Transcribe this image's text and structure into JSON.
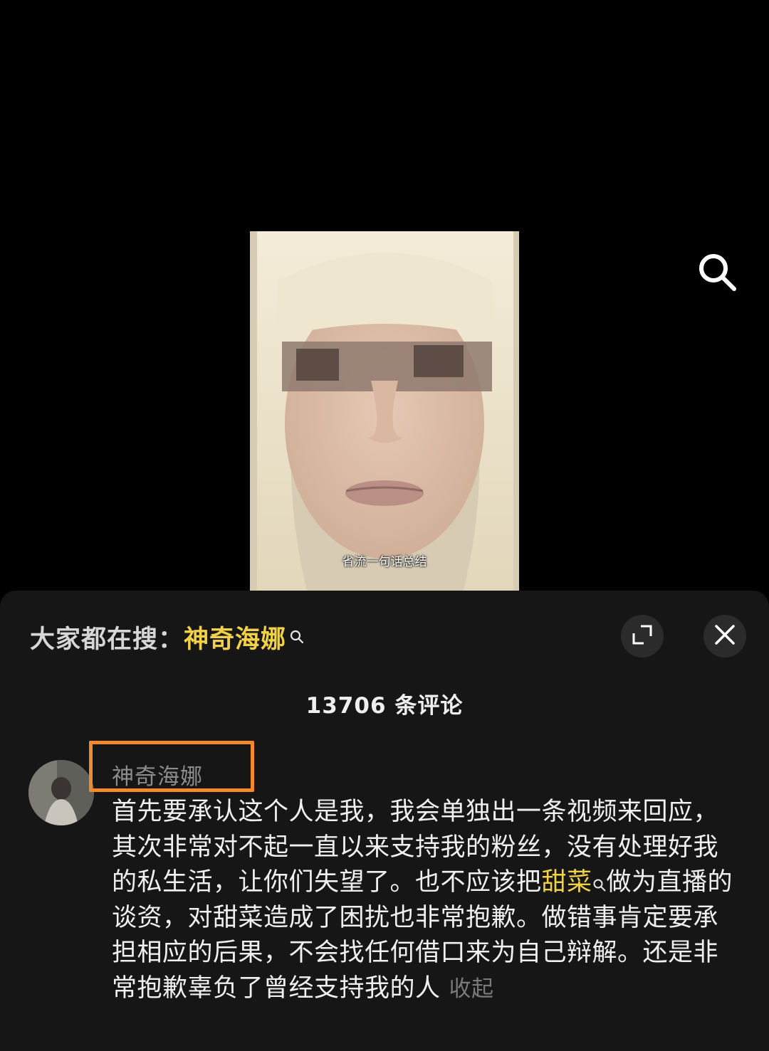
{
  "video": {
    "subtitle": "省流一句话总结"
  },
  "panel": {
    "search_prefix": "大家都在搜：",
    "search_term": "神奇海娜",
    "comment_count_label": "13706 条评论"
  },
  "comment": {
    "username": "神奇海娜",
    "text_part1": "首先要承认这个人是我，我会单独出一条视频来回应，其次非常对不起一直以来支持我的粉丝，没有处理好我的私生活，让你们失望了。也不应该把",
    "highlight": "甜菜",
    "text_part2": "做为直播的谈资，对甜菜造成了困扰也非常抱歉。做错事肯定要承担相应的后果，不会找任何借口来为自己辩解。还是非常抱歉辜负了曾经支持我的人",
    "collapse_label": "收起"
  },
  "colors": {
    "highlight": "#f1d04a",
    "annotation_box": "#f28a2a",
    "panel_bg": "#161616"
  },
  "icons": [
    "search-icon",
    "expand-icon",
    "close-icon",
    "mini-search-icon"
  ]
}
